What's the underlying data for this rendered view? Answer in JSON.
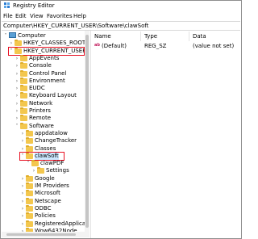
{
  "window": {
    "title": "Registry Editor"
  },
  "menu": [
    "File",
    "Edit",
    "View",
    "Favorites",
    "Help"
  ],
  "address": "Computer\\HKEY_CURRENT_USER\\Software\\clawSoft",
  "tree": [
    {
      "label": "Computer",
      "level": 0,
      "arrow": "open",
      "icon": "computer"
    },
    {
      "label": "HKEY_CLASSES_ROOT",
      "level": 1,
      "arrow": "closed",
      "icon": "folder"
    },
    {
      "label": "HKEY_CURRENT_USER",
      "level": 1,
      "arrow": "open",
      "icon": "folder",
      "highlight": true
    },
    {
      "label": "AppEvents",
      "level": 2,
      "arrow": "closed",
      "icon": "folder"
    },
    {
      "label": "Console",
      "level": 2,
      "arrow": "closed",
      "icon": "folder"
    },
    {
      "label": "Control Panel",
      "level": 2,
      "arrow": "closed",
      "icon": "folder"
    },
    {
      "label": "Environment",
      "level": 2,
      "arrow": "closed",
      "icon": "folder"
    },
    {
      "label": "EUDC",
      "level": 2,
      "arrow": "closed",
      "icon": "folder"
    },
    {
      "label": "Keyboard Layout",
      "level": 2,
      "arrow": "closed",
      "icon": "folder"
    },
    {
      "label": "Network",
      "level": 2,
      "arrow": "closed",
      "icon": "folder"
    },
    {
      "label": "Printers",
      "level": 2,
      "arrow": "closed",
      "icon": "folder"
    },
    {
      "label": "Remote",
      "level": 2,
      "arrow": "closed",
      "icon": "folder"
    },
    {
      "label": "Software",
      "level": 2,
      "arrow": "open",
      "icon": "folder"
    },
    {
      "label": "appdatalow",
      "level": 3,
      "arrow": "closed",
      "icon": "folder"
    },
    {
      "label": "ChangeTracker",
      "level": 3,
      "arrow": "closed",
      "icon": "folder"
    },
    {
      "label": "Classes",
      "level": 3,
      "arrow": "closed",
      "icon": "folder"
    },
    {
      "label": "clawSoft",
      "level": 3,
      "arrow": "open",
      "icon": "folder",
      "highlight": true,
      "selected": true
    },
    {
      "label": "clawPDF",
      "level": 4,
      "arrow": "open",
      "icon": "folder"
    },
    {
      "label": "Settings",
      "level": 5,
      "arrow": "closed",
      "icon": "folder"
    },
    {
      "label": "Google",
      "level": 3,
      "arrow": "closed",
      "icon": "folder"
    },
    {
      "label": "IM Providers",
      "level": 3,
      "arrow": "closed",
      "icon": "folder"
    },
    {
      "label": "Microsoft",
      "level": 3,
      "arrow": "closed",
      "icon": "folder"
    },
    {
      "label": "Netscape",
      "level": 3,
      "arrow": "closed",
      "icon": "folder"
    },
    {
      "label": "ODBC",
      "level": 3,
      "arrow": "closed",
      "icon": "folder"
    },
    {
      "label": "Policies",
      "level": 3,
      "arrow": "closed",
      "icon": "folder"
    },
    {
      "label": "RegisteredApplicatic",
      "level": 3,
      "arrow": "closed",
      "icon": "folder"
    },
    {
      "label": "Wow6432Node",
      "level": 3,
      "arrow": "closed",
      "icon": "folder"
    }
  ],
  "columns": {
    "name": "Name",
    "type": "Type",
    "data": "Data"
  },
  "values": [
    {
      "name": "(Default)",
      "type": "REG_SZ",
      "data": "(value not set)"
    }
  ],
  "colors": {
    "highlight_border": "#e81123",
    "folder": "#f3c74e",
    "selected_bg": "#cce8ff"
  }
}
